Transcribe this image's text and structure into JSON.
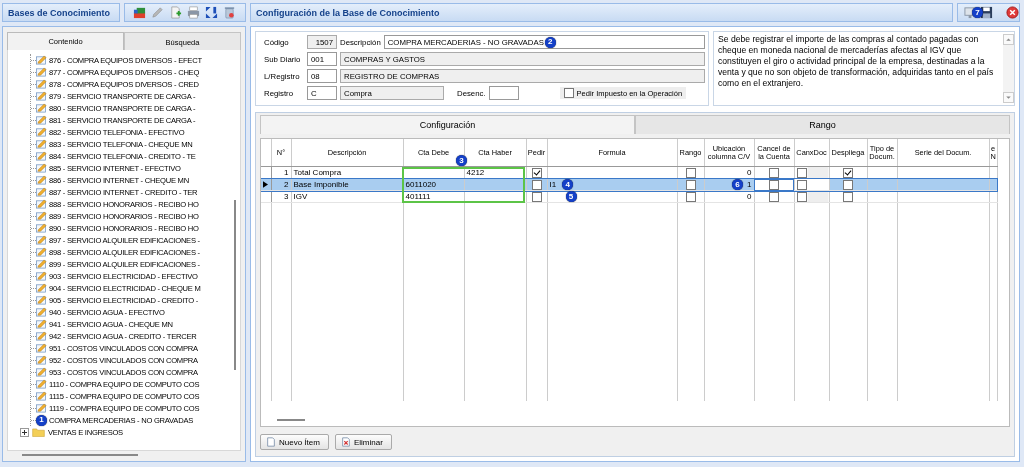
{
  "left_panel": {
    "title": "Bases de Conocimiento",
    "tabs": [
      {
        "label": "Contenido",
        "selected": true
      },
      {
        "label": "Búsqueda",
        "selected": false
      }
    ],
    "tree_items": [
      {
        "label": "876 - COMPRA EQUIPOS DIVERSOS - EFECT"
      },
      {
        "label": "877 - COMPRA EQUIPOS DIVERSOS - CHEQ"
      },
      {
        "label": "878 - COMPRA EQUIPOS DIVERSOS - CRED"
      },
      {
        "label": "879 - SERVICIO TRANSPORTE DE CARGA -"
      },
      {
        "label": "880 - SERVICIO TRANSPORTE DE CARGA -"
      },
      {
        "label": "881 - SERVICIO TRANSPORTE DE CARGA -"
      },
      {
        "label": "882 - SERVICIO TELEFONIA - EFECTIVO"
      },
      {
        "label": "883 - SERVICIO TELEFONIA - CHEQUE MN"
      },
      {
        "label": "884 - SERVICIO TELEFONIA - CREDITO - TE"
      },
      {
        "label": "885 - SERVICIO INTERNET - EFECTIVO"
      },
      {
        "label": "886 - SERVICIO INTERNET - CHEQUE MN"
      },
      {
        "label": "887 - SERVICIO INTERNET - CREDITO - TER"
      },
      {
        "label": "888 - SERVICIO HONORARIOS - RECIBO HO"
      },
      {
        "label": "889 - SERVICIO HONORARIOS - RECIBO HO"
      },
      {
        "label": "890 - SERVICIO HONORARIOS - RECIBO HO"
      },
      {
        "label": "897 - SERVICIO ALQUILER EDIFICACIONES -"
      },
      {
        "label": "898 - SERVICIO ALQUILER EDIFICACIONES -"
      },
      {
        "label": "899 - SERVICIO ALQUILER EDIFICACIONES -"
      },
      {
        "label": "903 - SERVICIO ELECTRICIDAD - EFECTIVO"
      },
      {
        "label": "904 - SERVICIO ELECTRICIDAD - CHEQUE M"
      },
      {
        "label": "905 - SERVICIO ELECTRICIDAD - CREDITO -"
      },
      {
        "label": "940 - SERVICIO AGUA - EFECTIVO"
      },
      {
        "label": "941 - SERVICIO AGUA - CHEQUE MN"
      },
      {
        "label": "942 - SERVICIO AGUA - CREDITO - TERCER"
      },
      {
        "label": "951 - COSTOS VINCULADOS CON COMPRA"
      },
      {
        "label": "952 - COSTOS VINCULADOS CON COMPRA"
      },
      {
        "label": "953 - COSTOS VINCULADOS CON COMPRA"
      },
      {
        "label": "1110 - COMPRA EQUIPO DE COMPUTO COS"
      },
      {
        "label": "1115 - COMPRA EQUIPO DE COMPUTO COS"
      },
      {
        "label": "1119 - COMPRA EQUIPO DE COMPUTO COS"
      },
      {
        "label": "COMPRA MERCADERIAS - NO GRAVADAS",
        "badge": "1"
      }
    ],
    "tree_folders": [
      {
        "label": "VENTAS E INGRESOS",
        "expanded": false
      }
    ]
  },
  "main": {
    "title": "Configuración de la Base de Conocimiento",
    "save_badge": "7",
    "form": {
      "codigo_label": "Código",
      "codigo": "1507",
      "descripcion_label": "Descripción",
      "descripcion": "COMPRA MERCADERIAS - NO GRAVADAS",
      "descripcion_badge": "2",
      "subdiario_label": "Sub Diario",
      "subdiario_code": "001",
      "subdiario_name": "COMPRAS Y GASTOS",
      "registro_libro_label": "L/Registro",
      "registro_libro_code": "08",
      "registro_libro_name": "REGISTRO DE COMPRAS",
      "registro_label": "Registro",
      "registro_code": "C",
      "registro_name": "Compra",
      "desenc_label": "Desenc.",
      "pedir_impuesto": {
        "label": "Pedir Impuesto en la Operación",
        "checked": false
      },
      "nota": "Se debe registrar el importe de las compras al contado pagadas con cheque en moneda nacional de mercaderías afectas al IGV que constituyen el giro o actividad principal de la empresa, destinadas a la venta y que no son objeto de transformación, adquiridas tanto en el país como en el extranjero."
    },
    "tabs": [
      {
        "label": "Configuración",
        "selected": true
      },
      {
        "label": "Rango",
        "selected": false
      }
    ],
    "grid": {
      "columns": [
        "N°",
        "Descripción",
        "Cta Debe",
        "Cta Haber",
        "Pedir",
        "Formula",
        "Rango",
        "Ubicación columna C/V",
        "Cancel de la Cuenta",
        "CanxDoc",
        "Despliega",
        "Tipo de Docum.",
        "Serie del Docum.",
        "e N"
      ],
      "highlight_badge": "3",
      "rows": [
        {
          "n": "1",
          "descripcion": "Total Compra",
          "cta_haber": "4212",
          "pedir": true,
          "rango": false,
          "ubicacion": "0",
          "cancel": false,
          "canxdoc": false,
          "despliega": true,
          "selected": false
        },
        {
          "n": "2",
          "descripcion": "Base Imponible",
          "cta_debe": "6011020",
          "pedir": false,
          "formula": "I1",
          "formula_badge": "4",
          "rango": false,
          "ubicacion": "1",
          "ubicacion_badge": "6",
          "cancel": false,
          "canxdoc": false,
          "despliega": false,
          "selected": true
        },
        {
          "n": "3",
          "descripcion": "IGV",
          "cta_debe": "401111",
          "pedir": false,
          "formula_badge": "5",
          "rango": false,
          "ubicacion": "0",
          "cancel": false,
          "canxdoc": false,
          "despliega": false,
          "selected": false
        }
      ]
    },
    "buttons": [
      {
        "kind": "new",
        "label": "Nuevo Ítem"
      },
      {
        "kind": "delete",
        "label": "Eliminar"
      }
    ]
  }
}
